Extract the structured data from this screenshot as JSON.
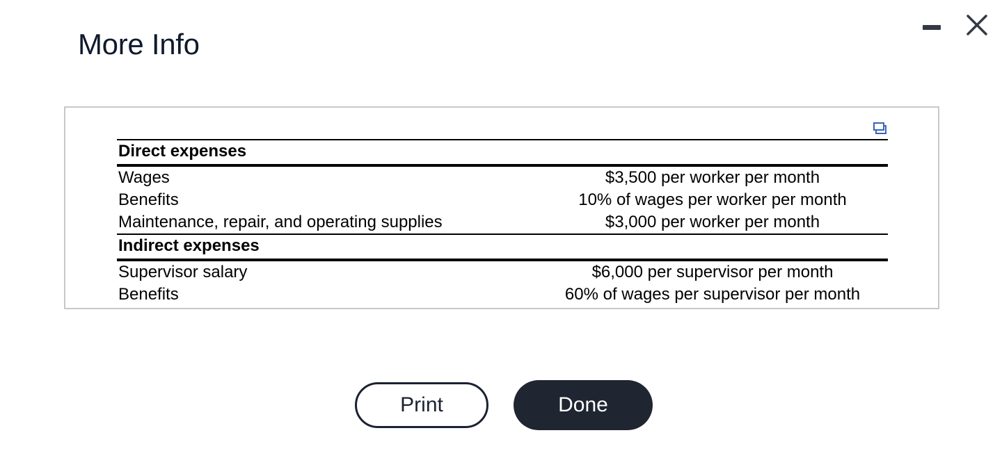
{
  "dialog": {
    "title": "More Info",
    "minimize_icon": "minimize-icon",
    "close_icon": "close-icon"
  },
  "table": {
    "copy_icon": "copy-icon",
    "sections": [
      {
        "header": "Direct expenses",
        "rows": [
          {
            "label": "Wages",
            "value": "$3,500 per worker per month"
          },
          {
            "label": "Benefits",
            "value": "10% of wages per worker per month"
          },
          {
            "label": "Maintenance, repair, and operating supplies",
            "value": "$3,000 per worker per month"
          }
        ]
      },
      {
        "header": "Indirect expenses",
        "rows": [
          {
            "label": "Supervisor salary",
            "value": "$6,000 per supervisor per month"
          },
          {
            "label": "Benefits",
            "value": "60% of wages per supervisor per month"
          }
        ]
      }
    ]
  },
  "buttons": {
    "print_label": "Print",
    "done_label": "Done"
  },
  "colors": {
    "primary_dark": "#1f2531",
    "border_gray": "#c8c8c8"
  }
}
